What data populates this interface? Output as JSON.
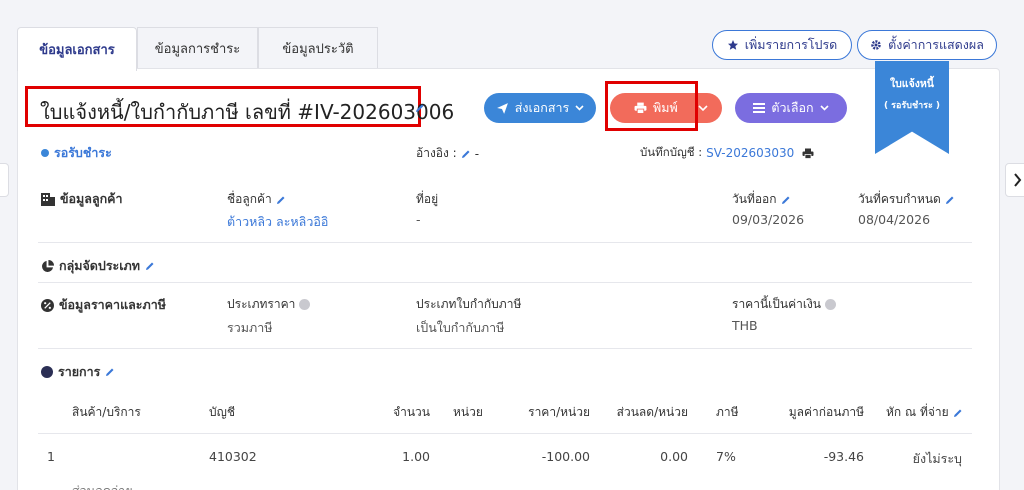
{
  "tabs": [
    {
      "label": "ข้อมูลเอกสาร",
      "active": true
    },
    {
      "label": "ข้อมูลการชำระ",
      "active": false
    },
    {
      "label": "ข้อมูลประวัติ",
      "active": false
    }
  ],
  "top_actions": {
    "favorite_label": "เพิ่มรายการโปรด",
    "display_settings_label": "ตั้งค่าการแสดงผล"
  },
  "ribbon": {
    "line1": "ใบแจ้งหนี้",
    "line2": "( รอรับชำระ )"
  },
  "header": {
    "title": "ใบแจ้งหนี้/ใบกำกับภาษี เลขที่ #IV-202603006",
    "send_label": "ส่งเอกสาร",
    "print_label": "พิมพ์",
    "options_label": "ตัวเลือก"
  },
  "status": {
    "label": "รอรับชำระ",
    "reference_label": "อ้างอิง :",
    "reference_value": "-",
    "journal_label": "บันทึกบัญชี :",
    "journal_value": "SV-202603030"
  },
  "customer": {
    "section_label": "ข้อมูลลูกค้า",
    "name_label": "ชื่อลูกค้า",
    "name_value": "ต้าวหลิว ละหลิวอิอิ",
    "address_label": "ที่อยู่",
    "address_value": "-",
    "issue_date_label": "วันที่ออก",
    "issue_date_value": "09/03/2026",
    "due_date_label": "วันที่ครบกำหนด",
    "due_date_value": "08/04/2026"
  },
  "classification": {
    "section_label": "กลุ่มจัดประเภท"
  },
  "pricing": {
    "section_label": "ข้อมูลราคาและภาษี",
    "price_type_label": "ประเภทราคา",
    "price_type_value": "รวมภาษี",
    "tax_invoice_type_label": "ประเภทใบกำกับภาษี",
    "tax_invoice_type_value": "เป็นใบกำกับภาษี",
    "currency_label": "ราคานี้เป็นค่าเงิน",
    "currency_value": "THB"
  },
  "items": {
    "section_label": "รายการ",
    "columns": [
      "สินค้า/บริการ",
      "บัญชี",
      "จำนวน",
      "หน่วย",
      "ราคา/หน่วย",
      "ส่วนลด/หน่วย",
      "ภาษี",
      "มูลค่าก่อนภาษี",
      "หัก ณ ที่จ่าย"
    ],
    "rows": [
      {
        "no": "1",
        "account": "410302",
        "qty": "1.00",
        "unit": "",
        "price": "-100.00",
        "discount": "0.00",
        "tax": "7%",
        "pre_tax": "-93.46",
        "wht": "ยังไม่ระบุ"
      }
    ],
    "partial_next": "ส่วนลดจ่าย"
  },
  "colors": {
    "primary": "#3b86d8",
    "print": "#f26b5b",
    "options": "#7b6de0",
    "highlight": "#e00000",
    "navy": "#2e3a8c"
  }
}
